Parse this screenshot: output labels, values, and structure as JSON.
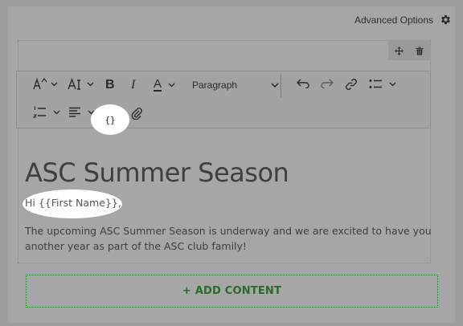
{
  "header": {
    "advanced_options": "Advanced Options"
  },
  "toolbar": {
    "bold": "B",
    "italic": "I",
    "font_color": "A",
    "paragraph": "Paragraph",
    "merge_tag": "{}"
  },
  "content": {
    "heading": "ASC Summer Season",
    "greeting": "Hi {{First Name}},",
    "body": "The upcoming ASC Summer Season is underway and we are excited to have you another year as part of the ASC club family!"
  },
  "add_content": {
    "label": "+ ADD CONTENT"
  },
  "icons": [
    "gear-icon",
    "move-icon",
    "trash-icon",
    "font-size-icon",
    "text-size-icon",
    "bold-icon",
    "italic-icon",
    "font-color-icon",
    "undo-icon",
    "redo-icon",
    "link-icon",
    "bullet-list-icon",
    "numbered-list-icon",
    "align-icon",
    "merge-tag-icon",
    "attachment-icon"
  ]
}
